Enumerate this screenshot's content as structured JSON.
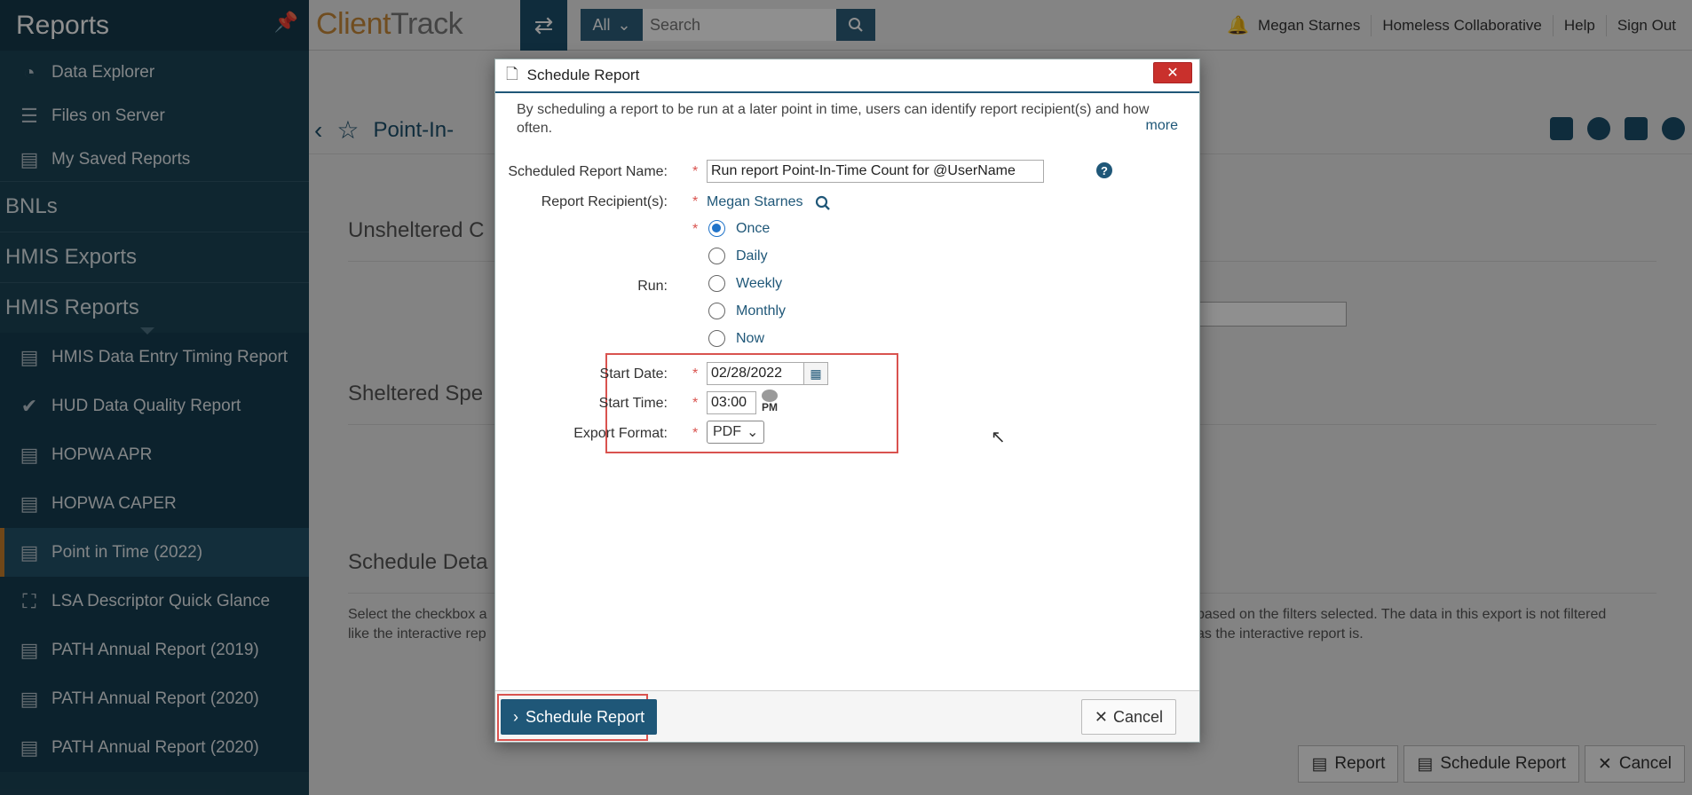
{
  "sidebar": {
    "title": "Reports",
    "top_items": [
      {
        "label": "Data Explorer",
        "icon": "compass-icon"
      },
      {
        "label": "Files on Server",
        "icon": "checklist-icon"
      },
      {
        "label": "My Saved Reports",
        "icon": "document-icon"
      }
    ],
    "sections": [
      "BNLs",
      "HMIS Exports",
      "HMIS Reports"
    ],
    "report_items": [
      {
        "label": "HMIS Data Entry Timing Report",
        "icon": "document-icon"
      },
      {
        "label": "HUD Data Quality Report",
        "icon": "check-circle-icon"
      },
      {
        "label": "HOPWA APR",
        "icon": "document-icon"
      },
      {
        "label": "HOPWA CAPER",
        "icon": "document-icon"
      },
      {
        "label": "Point in Time (2022)",
        "icon": "document-icon",
        "active": true
      },
      {
        "label": "LSA Descriptor Quick Glance",
        "icon": "map-icon"
      },
      {
        "label": "PATH Annual Report (2019)",
        "icon": "document-icon"
      },
      {
        "label": "PATH Annual Report (2020)",
        "icon": "document-icon"
      },
      {
        "label": "PATH Annual Report (2020)",
        "icon": "document-icon"
      }
    ]
  },
  "topbar": {
    "logo_client": "Client",
    "logo_track": "Track",
    "search_scope": "All",
    "search_placeholder": "Search",
    "user_name": "Megan Starnes",
    "organization": "Homeless Collaborative",
    "help": "Help",
    "sign_out": "Sign Out"
  },
  "page": {
    "title_partial": "Point-In-",
    "section1": "Unsheltered C",
    "section2": "Sheltered Spe",
    "section3": "Schedule Deta",
    "desc_left_1": "Select the checkbox a",
    "desc_left_2": "like the interactive rep",
    "desc_right_1": "based on the filters selected. The data in this export is not filtered",
    "desc_right_2": "as the interactive report is.",
    "footer": {
      "report": "Report",
      "schedule": "Schedule Report",
      "cancel": "Cancel"
    }
  },
  "modal": {
    "title": "Schedule Report",
    "intro": "By scheduling a report to be run at a later point in time, users can identify report recipient(s) and how often.",
    "more": "more",
    "name_label": "Scheduled Report Name:",
    "name_value": "Run report Point-In-Time Count for @UserName",
    "recipients_label": "Report Recipient(s):",
    "recipient": "Megan Starnes",
    "run_label": "Run:",
    "run_options": [
      "Once",
      "Daily",
      "Weekly",
      "Monthly",
      "Now"
    ],
    "run_selected": "Once",
    "start_date_label": "Start Date:",
    "start_date": "02/28/2022",
    "start_time_label": "Start Time:",
    "start_time": "03:00",
    "start_ampm": "PM",
    "export_label": "Export Format:",
    "export_value": "PDF",
    "required_mark": "*",
    "schedule_btn": "Schedule Report",
    "cancel_btn": "Cancel"
  },
  "colors": {
    "sidebar_bg": "#1c4457",
    "accent": "#1f5778",
    "required": "#d9534f",
    "radio_selected": "#1f73c9",
    "active_marker": "#c87f2b"
  }
}
